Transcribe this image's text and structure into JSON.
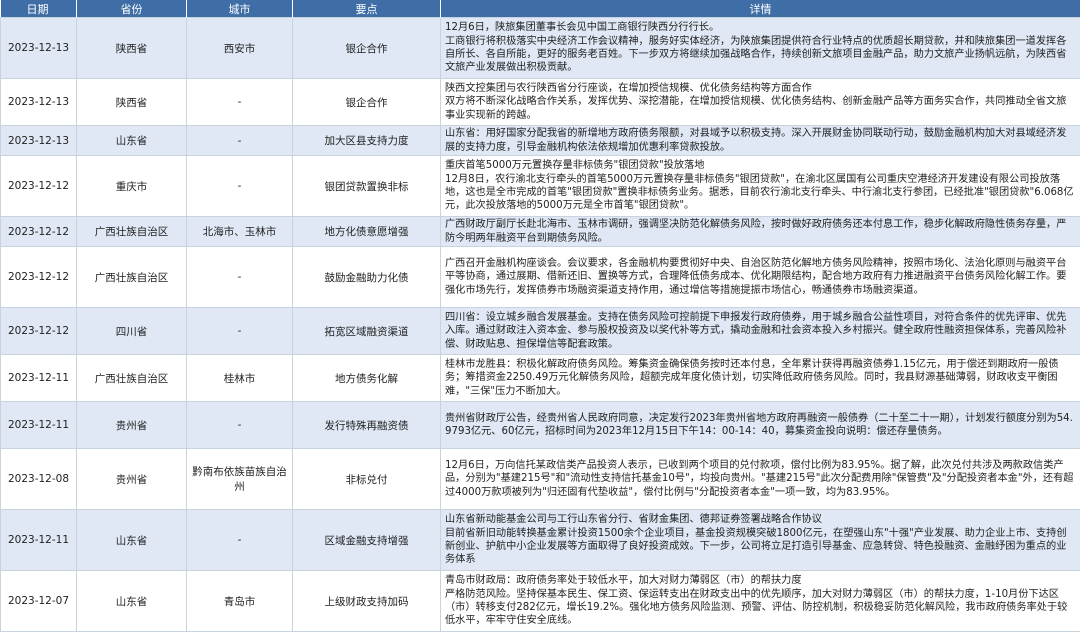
{
  "headers": {
    "date": "日期",
    "province": "省份",
    "city": "城市",
    "key": "要点",
    "detail": "详情"
  },
  "rows": [
    {
      "date": "2023-12-13",
      "province": "陕西省",
      "city": "西安市",
      "key": "银企合作",
      "detail": "12月6日，陕旅集团董事长会见中国工商银行陕西分行行长。\n工商银行将积极落实中央经济工作会议精神，服务好实体经济，为陕旅集团提供符合行业特点的优质超长期贷款，并和陕旅集团一道发挥各自所长、各自所能，更好的服务老百姓。下一步双方将继续加强战略合作，持续创新文旅项目金融产品，助力文旅产业扬帆远航，为陕西省文旅产业发展做出积极贡献。"
    },
    {
      "date": "2023-12-13",
      "province": "陕西省",
      "city": "-",
      "key": "银企合作",
      "detail": "陕西文控集团与农行陕西省分行座谈，在增加授信规模、优化债务结构等方面合作\n双方将不断深化战略合作关系，发挥优势、深挖潜能，在增加授信规模、优化债务结构、创新金融产品等方面务实合作，共同推动全省文旅事业实现新的跨越。"
    },
    {
      "date": "2023-12-13",
      "province": "山东省",
      "city": "-",
      "key": "加大区县支持力度",
      "detail": "山东省：用好国家分配我省的新增地方政府债务限额，对县域予以积极支持。深入开展财金协同联动行动，鼓励金融机构加大对县域经济发展的支持力度，引导金融机构依法依规增加优惠利率贷款投放。"
    },
    {
      "date": "2023-12-12",
      "province": "重庆市",
      "city": "-",
      "key": "银团贷款置换非标",
      "detail": "重庆首笔5000万元置换存量非标债务\"银团贷款\"投放落地\n12月8日，农行渝北支行牵头的首笔5000万元置换存量非标债务\"银团贷款\"，在渝北区属国有公司重庆空港经济开发建设有限公司投放落地，这也是全市完成的首笔\"银团贷款\"置换非标债务业务。据悉，目前农行渝北支行牵头、中行渝北支行参团，已经批准\"银团贷款\"6.068亿元，此次投放落地的5000万元是全市首笔\"银团贷款\"。"
    },
    {
      "date": "2023-12-12",
      "province": "广西壮族自治区",
      "city": "北海市、玉林市",
      "key": "地方化债意愿增强",
      "detail": "广西财政厅副厅长赴北海市、玉林市调研，强调坚决防范化解债务风险，按时做好政府债务还本付息工作，稳步化解政府隐性债务存量，严防今明两年融资平台到期债务风险。"
    },
    {
      "date": "2023-12-12",
      "province": "广西壮族自治区",
      "city": "-",
      "key": "鼓励金融助力化债",
      "detail": "广西召开金融机构座谈会。会议要求，各金融机构要贯彻好中央、自治区防范化解地方债务风险精神，按照市场化、法治化原则与融资平台平等协商，通过展期、借新还旧、置换等方式，合理降低债务成本、优化期限结构，配合地方政府有力推进融资平台债务风险化解工作。要强化市场先行，发挥债券市场融资渠道支持作用，通过增信等措施提振市场信心，畅通债券市场融资渠道。"
    },
    {
      "date": "2023-12-12",
      "province": "四川省",
      "city": "-",
      "key": "拓宽区域融资渠道",
      "detail": "四川省：设立城乡融合发展基金。支持在债务风险可控前提下申报发行政府债券，用于城乡融合公益性项目，对符合条件的优先评审、优先入库。通过财政注入资本金、参与股权投资及以奖代补等方式，撬动金融和社会资本投入乡村振兴。健全政府性融资担保体系，完善风险补偿、财政贴息、担保增信等配套政策。"
    },
    {
      "date": "2023-12-11",
      "province": "广西壮族自治区",
      "city": "桂林市",
      "key": "地方债务化解",
      "detail": "桂林市龙胜县：积极化解政府债务风险。筹集资金确保债务按时还本付息，全年累计获得再融资债券1.15亿元，用于偿还到期政府一般债务；筹措资金2250.49万元化解债务风险，超额完成年度化债计划，切实降低政府债务风险。同时，我县财源基础薄弱，财政收支平衡困难，\"三保\"压力不断加大。"
    },
    {
      "date": "2023-12-11",
      "province": "贵州省",
      "city": "-",
      "key": "发行特殊再融资债",
      "detail": "贵州省财政厅公告，经贵州省人民政府同意，决定发行2023年贵州省地方政府再融资一般债券（二十至二十一期），计划发行额度分别为54.9793亿元、60亿元，招标时间为2023年12月15日下午14：00-14：40，募集资金投向说明：偿还存量债务。"
    },
    {
      "date": "2023-12-08",
      "province": "贵州省",
      "city": "黔南布依族苗族自治州",
      "key": "非标兑付",
      "detail": "12月6日，万向信托某政信类产品投资人表示，已收到两个项目的兑付款项，偿付比例为83.95%。据了解，此次兑付共涉及两款政信类产品，分别为\"基建215号\"和\"流动性支持信托基金10号\"，均投向贵州。\"基建215号\"此次分配费用除\"保管费\"及\"分配投资者本金\"外，还有超过4000万款项被列为\"归还固有代垫收益\"，偿付比例与\"分配投资者本金\"一项一致，均为83.95%。"
    },
    {
      "date": "2023-12-11",
      "province": "山东省",
      "city": "-",
      "key": "区域金融支持增强",
      "detail": "山东省新动能基金公司与工行山东省分行、省财金集团、德邦证券签署战略合作协议\n目前省新旧动能转换基金累计投资1500余个企业项目，基金投资规模突破1800亿元，在塑强山东\"十强\"产业发展、助力企业上市、支持创新创业、护航中小企业发展等方面取得了良好投资成效。下一步，公司将立足打造引导基金、应急转贷、特色投融资、金融纾困为重点的业务体系"
    },
    {
      "date": "2023-12-07",
      "province": "山东省",
      "city": "青岛市",
      "key": "上级财政支持加码",
      "detail": "青岛市财政局：政府债务率处于较低水平，加大对财力薄弱区（市）的帮扶力度\n严格防范风险。坚持保基本民生、保工资、保运转支出在财政支出中的优先顺序，加大对财力薄弱区（市）的帮扶力度，1-10月份下达区（市）转移支付282亿元，增长19.2%。强化地方债务风险监测、预警、评估、防控机制，积极稳妥防范化解风险，我市政府债务率处于较低水平，牢牢守住安全底线。"
    }
  ]
}
